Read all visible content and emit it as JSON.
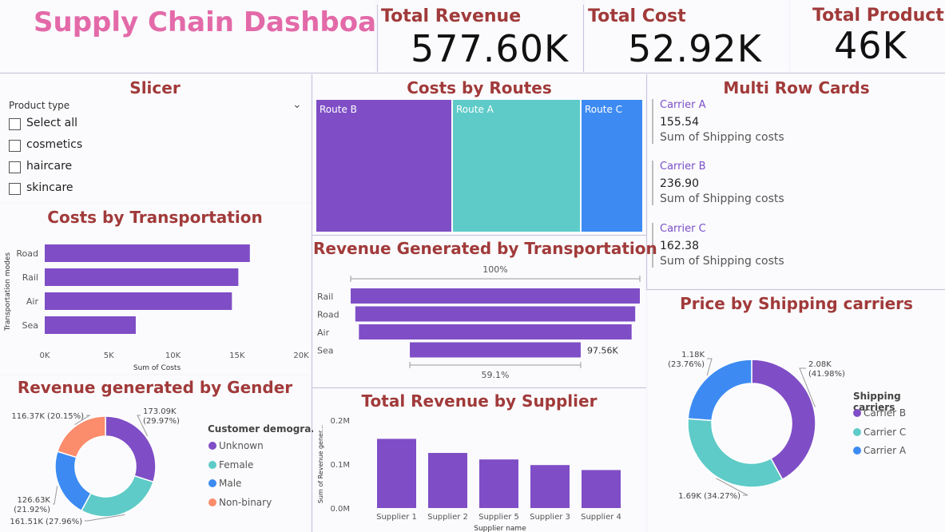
{
  "header": {
    "title": "Supply Chain Dashboard",
    "kpis": [
      {
        "label": "Total Revenue",
        "value": "577.60K"
      },
      {
        "label": "Total Cost",
        "value": "52.92K"
      },
      {
        "label": "Total Product",
        "value": "46K"
      }
    ]
  },
  "slicer": {
    "title": "Slicer",
    "field": "Product type",
    "options": [
      "Select all",
      "cosmetics",
      "haircare",
      "skincare"
    ]
  },
  "costs_by_routes": {
    "title": "Costs by Routes",
    "routes": [
      {
        "label": "Route B",
        "color": "#7f4ec6"
      },
      {
        "label": "Route A",
        "color": "#5ecbc8"
      },
      {
        "label": "Route C",
        "color": "#3d8bf2"
      }
    ]
  },
  "multi_row_cards": {
    "title": "Multi Row Cards",
    "cards": [
      {
        "category": "Carrier A",
        "value": "155.54",
        "label": "Sum of Shipping costs"
      },
      {
        "category": "Carrier B",
        "value": "236.90",
        "label": "Sum of Shipping costs"
      },
      {
        "category": "Carrier C",
        "value": "162.38",
        "label": "Sum of Shipping costs"
      }
    ]
  },
  "costs_by_transportation": {
    "title": "Costs by Transportation",
    "ylabel": "Transportation modes",
    "xlabel": "Sum of Costs",
    "ticks": [
      "0K",
      "5K",
      "10K",
      "15K",
      "20K"
    ]
  },
  "revenue_by_transportation": {
    "title": "Revenue Generated by Transportation",
    "top_label": "100%",
    "bottom_label": "59.1%",
    "sea_label": "97.56K"
  },
  "price_by_carriers": {
    "title": "Price by Shipping carriers",
    "legend_title": "Shipping carriers"
  },
  "revenue_by_gender": {
    "title": "Revenue generated by Gender",
    "legend_title": "Customer demogra..."
  },
  "revenue_by_supplier": {
    "title": "Total Revenue by Supplier",
    "ylabel": "Sum of Revenue gener...",
    "xlabel": "Supplier name",
    "ticks": [
      "0.0M",
      "0.1M",
      "0.2M"
    ]
  },
  "chart_data": [
    {
      "type": "bar",
      "orientation": "horizontal",
      "title": "Costs by Transportation",
      "categories": [
        "Road",
        "Rail",
        "Air",
        "Sea"
      ],
      "values": [
        16000,
        15100,
        14600,
        7100
      ],
      "xlabel": "Sum of Costs",
      "ylabel": "Transportation modes",
      "xlim": [
        0,
        20000
      ],
      "color": "#7f4ec6"
    },
    {
      "type": "bar",
      "orientation": "funnel",
      "title": "Revenue Generated by Transportation",
      "categories": [
        "Rail",
        "Road",
        "Air",
        "Sea"
      ],
      "values": [
        165100,
        159800,
        155700,
        97560
      ],
      "color": "#7f4ec6"
    },
    {
      "type": "pie",
      "title": "Price by Shipping carriers",
      "labels": [
        "Carrier B",
        "Carrier C",
        "Carrier A"
      ],
      "values": [
        2080,
        1690,
        1180
      ],
      "percents": [
        41.98,
        34.27,
        23.76
      ],
      "value_labels": [
        "2.08K",
        "1.69K",
        "1.18K"
      ],
      "colors": [
        "#7f4ec6",
        "#5ecbc8",
        "#3d8bf2"
      ]
    },
    {
      "type": "pie",
      "title": "Revenue generated by Gender",
      "labels": [
        "Unknown",
        "Female",
        "Male",
        "Non-binary"
      ],
      "values": [
        173090,
        161510,
        126630,
        116370
      ],
      "percents": [
        29.97,
        27.96,
        21.92,
        20.15
      ],
      "value_labels": [
        "173.09K",
        "161.51K",
        "126.63K",
        "116.37K"
      ],
      "colors": [
        "#7f4ec6",
        "#5ecbc8",
        "#3d8bf2",
        "#fb8c6c"
      ]
    },
    {
      "type": "bar",
      "title": "Total Revenue by Supplier",
      "categories": [
        "Supplier 1",
        "Supplier 2",
        "Supplier 5",
        "Supplier 3",
        "Supplier 4"
      ],
      "values": [
        157500,
        125400,
        110600,
        97800,
        86500
      ],
      "xlabel": "Supplier name",
      "ylabel": "Sum of Revenue gener...",
      "ylim": [
        0,
        200000
      ],
      "color": "#7f4ec6"
    }
  ]
}
